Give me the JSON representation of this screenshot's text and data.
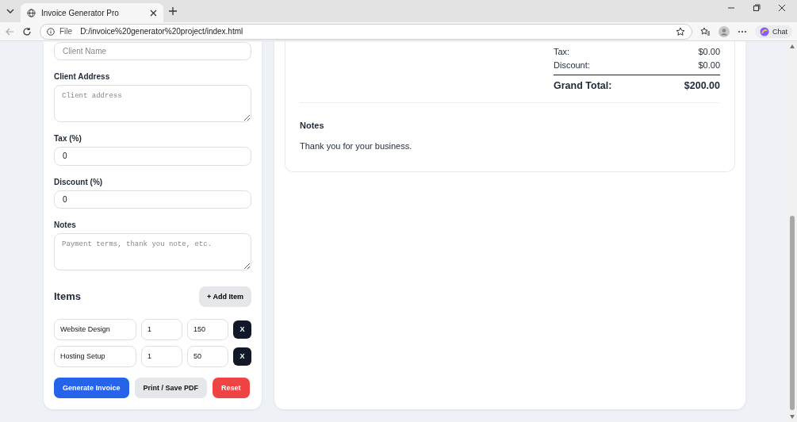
{
  "browser": {
    "tab_title": "Invoice Generator Pro",
    "url_scheme": "File",
    "url": "D:/invoice%20generator%20project/index.html",
    "chat_label": "Chat"
  },
  "form": {
    "fields": [
      {
        "kind": "input",
        "placeholder": "Client Name"
      },
      {
        "kind": "textarea",
        "label": "Client Address",
        "placeholder": "Client address"
      },
      {
        "kind": "input",
        "label": "Tax (%)",
        "value": "0"
      },
      {
        "kind": "input",
        "label": "Discount (%)",
        "value": "0"
      },
      {
        "kind": "textarea",
        "label": "Notes",
        "placeholder": "Payment terms, thank you note, etc."
      }
    ],
    "items_title": "Items",
    "add_button": "+ Add Item",
    "items": [
      {
        "description": "Website Design",
        "quantity": "1",
        "price": "150",
        "remove": "X"
      },
      {
        "description": "Hosting Setup",
        "quantity": "1",
        "price": "50",
        "remove": "X"
      }
    ],
    "actions": [
      {
        "label": "Generate Invoice",
        "kind": "primary"
      },
      {
        "label": "Print / Save PDF",
        "kind": "secondary"
      },
      {
        "label": "Reset",
        "kind": "danger"
      }
    ]
  },
  "preview": {
    "summary": [
      {
        "label": "Tax:",
        "value": "$0.00"
      },
      {
        "label": "Discount:",
        "value": "$0.00"
      }
    ],
    "grand_total": {
      "label": "Grand Total:",
      "value": "$200.00"
    },
    "notes": {
      "title": "Notes",
      "text": "Thank you for your business."
    }
  }
}
